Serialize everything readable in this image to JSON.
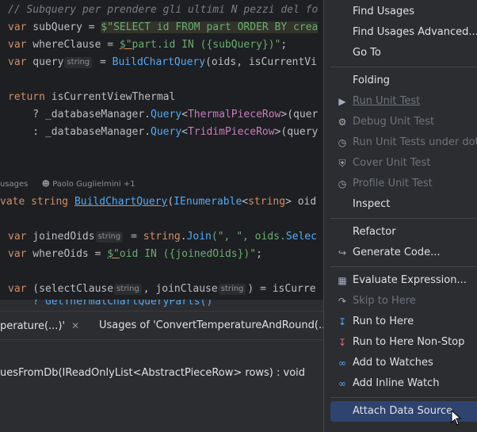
{
  "editor": {
    "lines": {
      "l0": "// Subquery per prendere gli ultimi N pezzi del fo",
      "l1_a": "var",
      "l1_b": " subQuery = ",
      "l1_c": "$\"",
      "l1_d": "SELECT id FROM part ORDER BY crea",
      "l2_a": "var",
      "l2_b": " whereClause = ",
      "l2_c": "$\"",
      "l2_d": "part.id IN ({subQuery})\"",
      "l2_e": ";",
      "l3_a": "var",
      "l3_b": " query",
      "l3_hint": "string",
      "l3_c": " = ",
      "l3_d": "BuildChartQuery",
      "l3_e": "(oids, isCurrentVi",
      "l5_a": "return",
      "l5_b": " isCurrentViewThermal",
      "l6_a": "    ? _databaseManager.",
      "l6_b": "Query",
      "l6_c": "<",
      "l6_d": "ThermalPieceRow",
      "l6_e": ">(quer",
      "l7_a": "    : _databaseManager.",
      "l7_b": "Query",
      "l7_c": "<",
      "l7_d": "TridimPieceRow",
      "l7_e": ">(query",
      "meta_usages": "usages",
      "meta_author": "Paolo Guglielmini +1",
      "l9_a": "vate",
      "l9_b": " string ",
      "l9_c": "BuildChartQuery",
      "l9_d": "(",
      "l9_e": "IEnumerable",
      "l9_f": "<",
      "l9_g": "string",
      "l9_h": "> oid",
      "l11_a": "var",
      "l11_b": " joinedOids",
      "l11_hint": "string",
      "l11_c": " = ",
      "l11_d": "string",
      "l11_e": ".",
      "l11_f": "Join",
      "l11_g": "(\", \", oids.",
      "l11_h": "Selec",
      "l12_a": "var",
      "l12_b": " whereOids = ",
      "l12_c": "$\"",
      "l12_d": "oid IN ({joinedOids})\"",
      "l12_e": ";",
      "l14_a": "var",
      "l14_b": " (selectClause",
      "l14_hint1": "string",
      "l14_c": ", joinClause",
      "l14_hint2": "string",
      "l14_d": ") = isCurre",
      "l15": "    ? GetThermalChartQueryParts()"
    }
  },
  "panel": {
    "tab1": "perature(...)'",
    "tab2": "Usages of 'ConvertTemperatureAndRound(...",
    "close_glyph": "✕",
    "result_text": "uesFromDb(IReadOnlyList<AbstractPieceRow> rows) : void"
  },
  "menu": {
    "find_usages": "Find Usages",
    "find_usages_advanced": "Find Usages Advanced...",
    "go_to": "Go To",
    "folding": "Folding",
    "run_unit_test": "Run Unit Test",
    "debug_unit_test": "Debug Unit Test",
    "run_unit_tests_under_dot": "Run Unit Tests under dot",
    "cover_unit_test": "Cover Unit Test",
    "profile_unit_test": "Profile Unit Test",
    "inspect": "Inspect",
    "refactor": "Refactor",
    "generate_code": "Generate Code...",
    "evaluate_expression": "Evaluate Expression...",
    "skip_to_here": "Skip to Here",
    "run_to_here": "Run to Here",
    "run_to_here_non_stop": "Run to Here Non-Stop",
    "add_to_watches": "Add to Watches",
    "add_inline_watch": "Add Inline Watch",
    "attach_data_source": "Attach Data Source"
  },
  "icons": {
    "run": "play-icon",
    "debug": "bug-icon",
    "shield": "shield-icon",
    "timer": "timer-icon",
    "generate": "generate-icon",
    "calculator": "calculator-icon",
    "step": "step-icon",
    "watch": "glasses-icon"
  },
  "colors": {
    "selection": "#2e436e",
    "keyword": "#cf8e6d",
    "string": "#6aab73",
    "function": "#56a8f5"
  }
}
